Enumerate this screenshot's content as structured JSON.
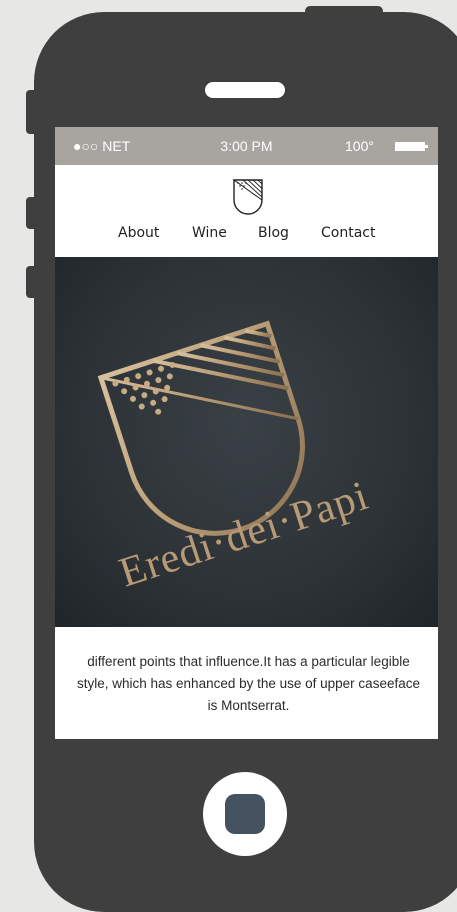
{
  "statusbar": {
    "carrier": "●○○ NET",
    "time": "3:00 PM",
    "battery": "100°"
  },
  "nav": {
    "items": [
      "About",
      "Wine",
      "Blog",
      "Contact"
    ]
  },
  "hero": {
    "brand_text": "Eredi·dei·Papi"
  },
  "content": {
    "paragraph": "different points that influence.It has a particular legible style, which has enhanced by the use of upper caseeface is Montserrat."
  },
  "colors": {
    "phone_body": "#3f3f3f",
    "statusbar": "#a8a5a0",
    "home_inner": "#44535f",
    "gold": "#b89b74",
    "background": "#e7e8e6"
  }
}
